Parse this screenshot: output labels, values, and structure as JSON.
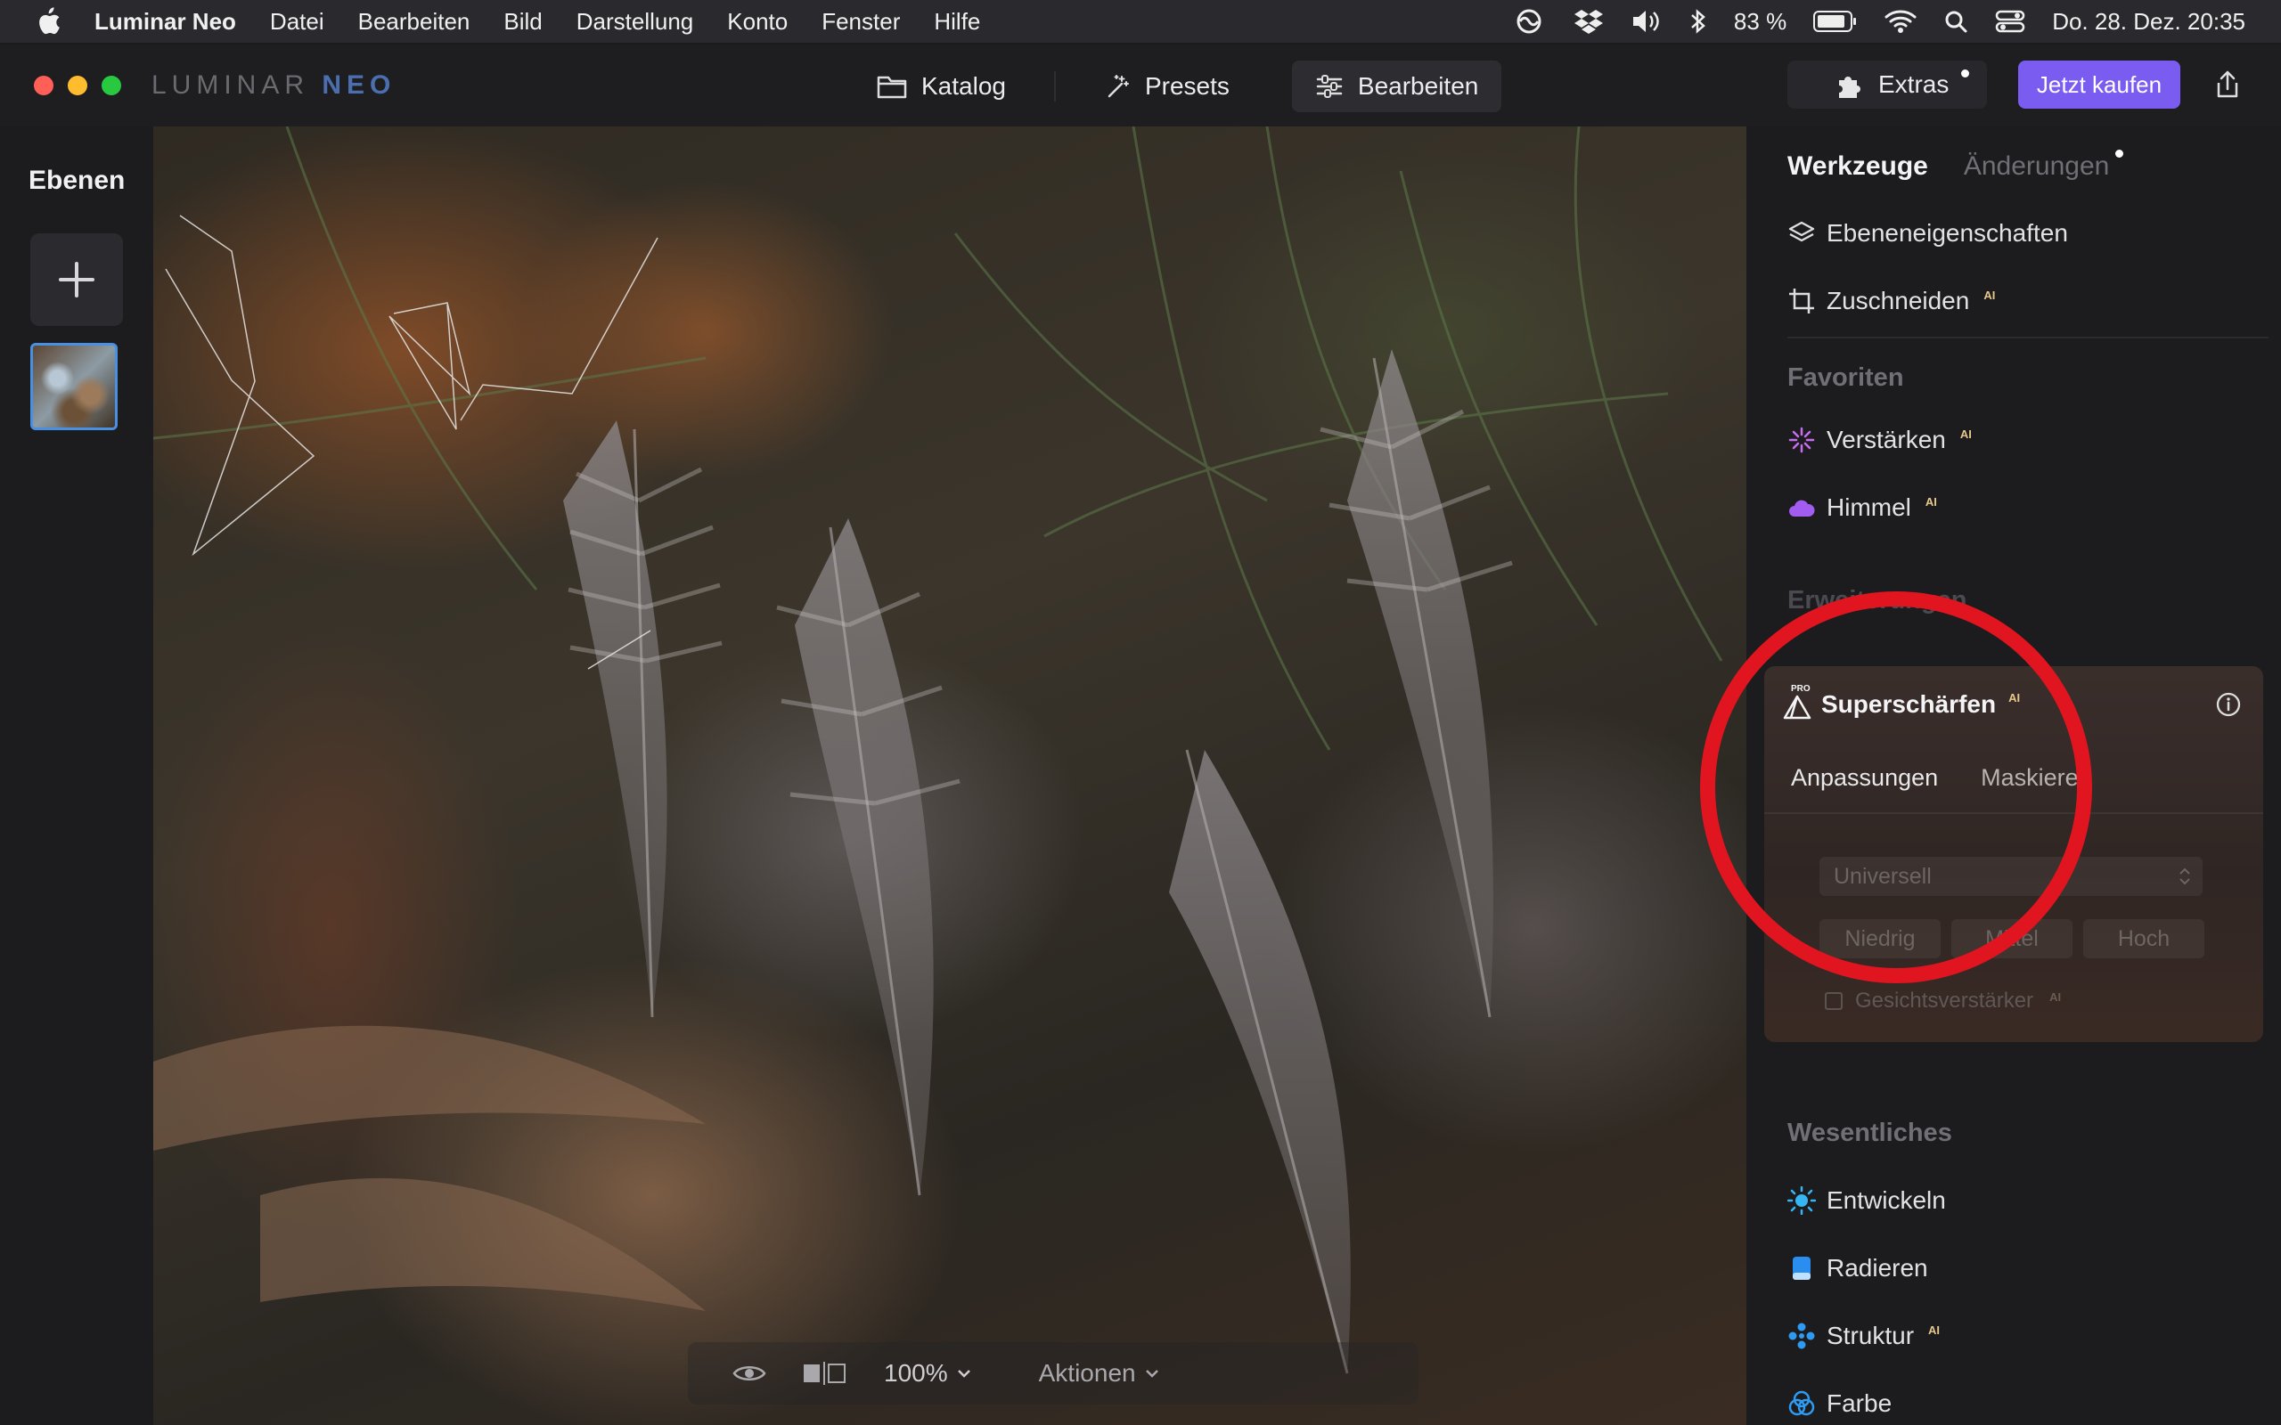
{
  "menubar": {
    "app_name": "Luminar Neo",
    "items": [
      "Datei",
      "Bearbeiten",
      "Bild",
      "Darstellung",
      "Konto",
      "Fenster",
      "Hilfe"
    ],
    "battery": "83 %",
    "datetime": "Do. 28. Dez.  20:35"
  },
  "toolbar": {
    "logo_text": "LUMINAR",
    "logo_accent": "NEO",
    "modes": [
      "Katalog",
      "Presets",
      "Bearbeiten"
    ],
    "active_mode": "Bearbeiten",
    "extras_label": "Extras",
    "buy_label": "Jetzt kaufen"
  },
  "layers": {
    "title": "Ebenen"
  },
  "canvas": {
    "zoom": "100%",
    "actions_label": "Aktionen"
  },
  "panel": {
    "tab_tools": "Werkzeuge",
    "tab_changes": "Änderungen",
    "tools_top": [
      {
        "label": "Ebeneneigenschaften",
        "ai": ""
      },
      {
        "label": "Zuschneiden",
        "ai": "AI"
      }
    ],
    "favorites_label": "Favoriten",
    "favorites": [
      {
        "label": "Verstärken",
        "ai": "AI"
      },
      {
        "label": "Himmel",
        "ai": "AI"
      }
    ],
    "extensions_label": "Erweiterungen",
    "sharpen": {
      "pro_badge": "PRO",
      "title": "Superschärfen",
      "ai": "AI",
      "tab_adjust": "Anpassungen",
      "tab_mask": "Maskieren",
      "mode_value": "Universell",
      "levels": [
        "Niedrig",
        "Mittel",
        "Hoch"
      ],
      "face_label": "Gesichtsverstärker",
      "face_ai": "AI"
    },
    "essentials_label": "Wesentliches",
    "essentials": [
      {
        "label": "Entwickeln",
        "ai": ""
      },
      {
        "label": "Radieren",
        "ai": ""
      },
      {
        "label": "Struktur",
        "ai": "AI"
      },
      {
        "label": "Farbe",
        "ai": ""
      }
    ]
  },
  "colors": {
    "accent_purple": "#7b5cf0",
    "annotation_red": "#e0151f",
    "selection_blue": "#4a90e2"
  }
}
